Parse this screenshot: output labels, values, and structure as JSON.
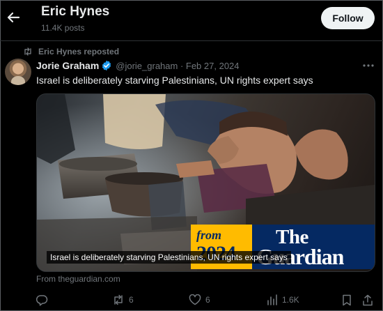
{
  "header": {
    "title": "Eric Hynes",
    "subtitle": "11.4K posts",
    "follow_label": "Follow",
    "back_icon": "arrow-left-icon"
  },
  "tweet": {
    "repost_text": "Eric Hynes reposted",
    "author_name": "Jorie Graham",
    "handle_and_date": "@jorie_graham · Feb 27, 2024",
    "text": "Israel is deliberately starving Palestinians, UN rights expert says",
    "verified": true,
    "verified_color": "#1d9bf0"
  },
  "card": {
    "caption": "Israel is deliberately starving Palestinians, UN rights expert says",
    "brand_from": "from",
    "brand_year": "2024",
    "brand_the": "The",
    "brand_name": "Guardian",
    "brand_colors": {
      "yellow": "#ffbb00",
      "blue": "#052962"
    },
    "source": "From theguardian.com"
  },
  "actions": {
    "reply": {
      "icon": "reply-icon",
      "count": ""
    },
    "retweet": {
      "icon": "retweet-icon",
      "count": "6"
    },
    "like": {
      "icon": "heart-icon",
      "count": "6"
    },
    "views": {
      "icon": "views-chart-icon",
      "count": "1.6K"
    },
    "bookmark": {
      "icon": "bookmark-icon"
    },
    "share": {
      "icon": "share-icon"
    }
  },
  "colors": {
    "background": "#000000",
    "text_primary": "#e7e9ea",
    "text_secondary": "#71767b",
    "follow_bg": "#eff3f4"
  }
}
